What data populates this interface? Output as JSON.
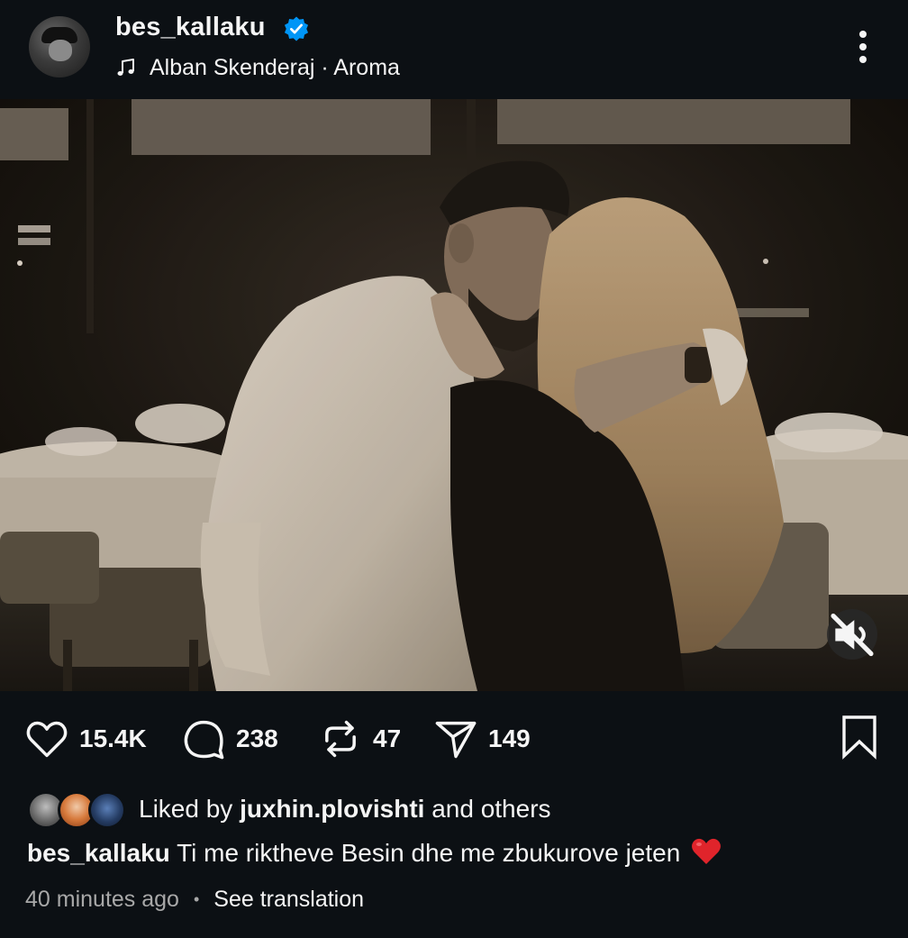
{
  "post": {
    "username": "bes_kallaku",
    "audio": "Alban Skenderaj · Aroma",
    "stats": {
      "likes": "15.4K",
      "comments": "238",
      "reposts": "47",
      "shares": "149"
    },
    "liked_by": {
      "prefix": "Liked by",
      "user": "juxhin.plovishti",
      "suffix": "and others"
    },
    "caption": {
      "username": "bes_kallaku",
      "text": "Ti me riktheve Besin dhe me zbukurove jeten"
    },
    "timestamp": "40 minutes ago",
    "translate_label": "See translation"
  },
  "icons": {
    "verified": "verified-badge-icon",
    "music": "music-note-icon",
    "more": "more-vertical-icon",
    "mute": "speaker-muted-icon",
    "like": "heart-icon",
    "comment": "comment-bubble-icon",
    "repost": "repost-icon",
    "share": "paper-plane-icon",
    "save": "bookmark-icon"
  },
  "colors": {
    "background": "#0c1014",
    "text": "#f5f5f5",
    "muted_text": "#a8a8a8",
    "verified_blue": "#0095f6",
    "emoji_red": "#e0242b"
  }
}
